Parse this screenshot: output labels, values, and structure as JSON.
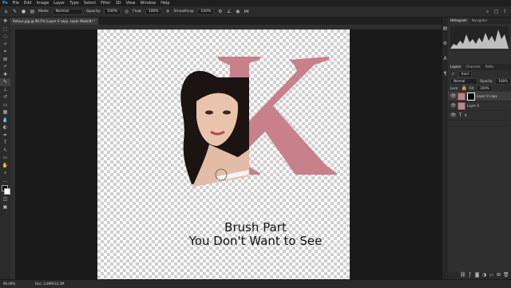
{
  "menubar": {
    "items": [
      "File",
      "Edit",
      "Image",
      "Layer",
      "Type",
      "Select",
      "Filter",
      "3D",
      "View",
      "Window",
      "Help"
    ]
  },
  "options": {
    "mode_label": "Mode:",
    "mode_value": "Normal",
    "opacity_label": "Opacity:",
    "opacity_value": "100%",
    "flow_label": "Flow:",
    "flow_value": "100%",
    "smoothing_label": "Smoothing:",
    "smoothing_value": "100%"
  },
  "document": {
    "tab_title": "Retouc.jpg @ 96.5% (Layer 0 copy, Layer Mask/8) *"
  },
  "canvas": {
    "caption_line1": "Brush Part",
    "caption_line2": "You Don't Want to See",
    "letter": "K",
    "letter_color": "#c8808a"
  },
  "status": {
    "zoom": "96.49%",
    "doc_info": "Doc: 2.89M/10.3M"
  },
  "panels": {
    "top_tabs": [
      "Histogram",
      "Navigator"
    ],
    "layer_tabs": [
      "Layers",
      "Channels",
      "Paths"
    ],
    "kind_label": "Kind",
    "blend_mode": "Normal",
    "opacity_label": "Opacity:",
    "opacity_value": "100%",
    "lock_label": "Lock:",
    "fill_label": "Fill:",
    "fill_value": "100%",
    "layers": [
      {
        "name": "Layer 0 copy"
      },
      {
        "name": "Layer 0"
      },
      {
        "name": "K"
      }
    ]
  }
}
